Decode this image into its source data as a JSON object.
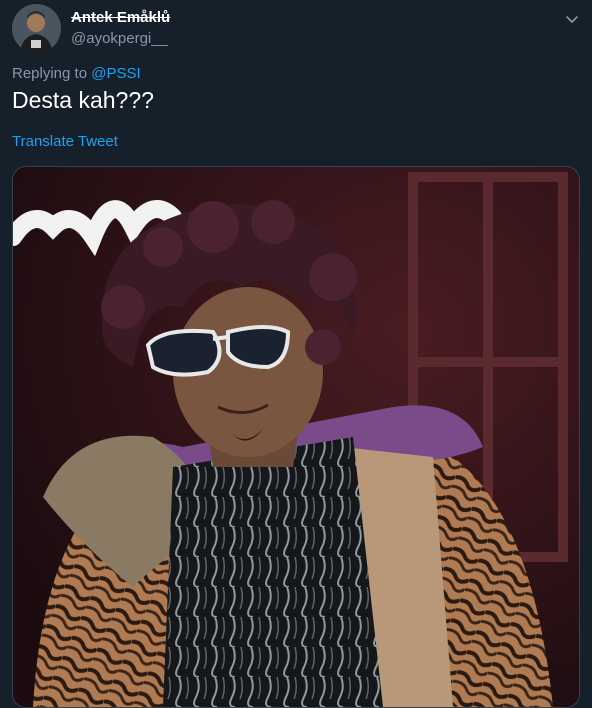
{
  "tweet": {
    "display_name": "Antek Emåklů",
    "handle": "@ayokpergi__",
    "replying_prefix": "Replying to",
    "replying_to": "@PSSI",
    "text": "Desta kah???",
    "translate_label": "Translate Tweet"
  },
  "icons": {
    "menu": "chevron-down-icon",
    "avatar": "avatar-photo"
  },
  "colors": {
    "background": "#15202b",
    "primary_text": "#ffffff",
    "secondary_text": "#8899a6",
    "link": "#1da1f2",
    "border": "#38444d"
  }
}
